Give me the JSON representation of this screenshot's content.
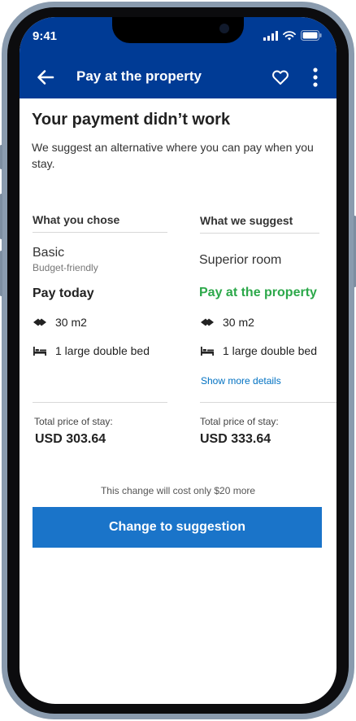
{
  "status_bar": {
    "time": "9:41"
  },
  "app_bar": {
    "title": "Pay at the property"
  },
  "main": {
    "heading": "Your payment didn’t work",
    "subtitle": "We suggest an alternative where you can pay when you stay."
  },
  "chosen": {
    "header": "What you chose",
    "plan_name": "Basic",
    "plan_sub": "Budget-friendly",
    "payment": "Pay today",
    "size": "30 m2",
    "bed": "1 large double bed",
    "total_label": "Total price of stay:",
    "total_price": "USD 303.64"
  },
  "suggested": {
    "header": "What we suggest",
    "plan_name": "Superior room",
    "payment": "Pay at the property",
    "size": "30 m2",
    "bed": "1 large double bed",
    "details_link": "Show more details",
    "total_label": "Total price of stay:",
    "total_price": "USD 333.64"
  },
  "footer": {
    "note": "This change will cost only $20 more",
    "cta_label": "Change to suggestion"
  },
  "icons": {
    "back": "arrow-left-icon",
    "favorite": "heart-icon",
    "menu": "more-vertical-icon",
    "size": "room-size-icon",
    "bed": "bed-icon"
  },
  "colors": {
    "brand": "#003b95",
    "primary_button": "#1a74c9",
    "highlight_green": "#2ca84a",
    "link": "#0071c2"
  }
}
